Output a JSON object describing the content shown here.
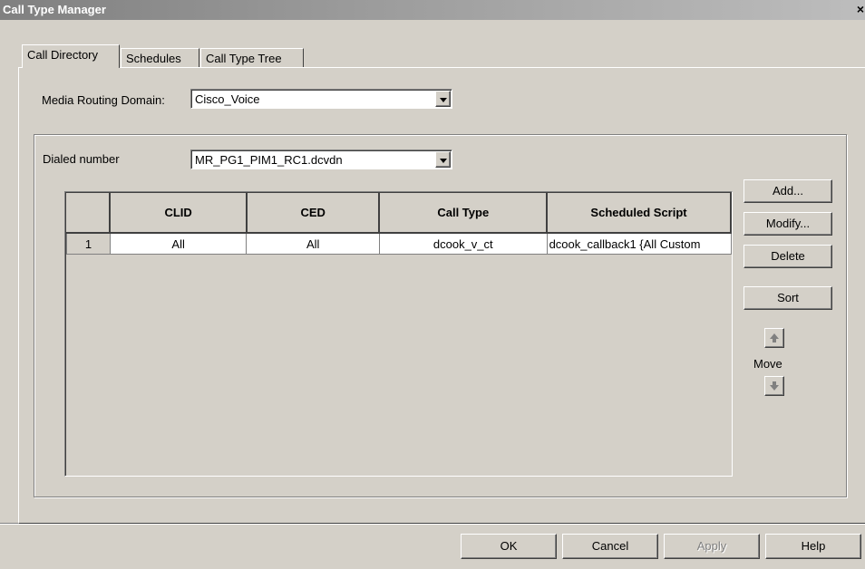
{
  "window": {
    "title": "Call Type Manager",
    "close_label": "×"
  },
  "tabs": [
    {
      "label": "Call Directory"
    },
    {
      "label": "Schedules"
    },
    {
      "label": "Call Type Tree"
    }
  ],
  "media_routing_domain": {
    "label": "Media Routing Domain:",
    "value": "Cisco_Voice"
  },
  "dialed_number": {
    "label": "Dialed number",
    "value": "MR_PG1_PIM1_RC1.dcvdn"
  },
  "table": {
    "columns": [
      "",
      "CLID",
      "CED",
      "Call Type",
      "Scheduled Script"
    ],
    "rows": [
      {
        "num": "1",
        "clid": "All",
        "ced": "All",
        "call_type": "dcook_v_ct",
        "script": "dcook_callback1 {All Custom"
      }
    ]
  },
  "side_buttons": {
    "add": "Add...",
    "modify": "Modify...",
    "delete": "Delete",
    "sort": "Sort",
    "move": "Move"
  },
  "footer": {
    "ok": "OK",
    "cancel": "Cancel",
    "apply": "Apply",
    "help": "Help"
  }
}
